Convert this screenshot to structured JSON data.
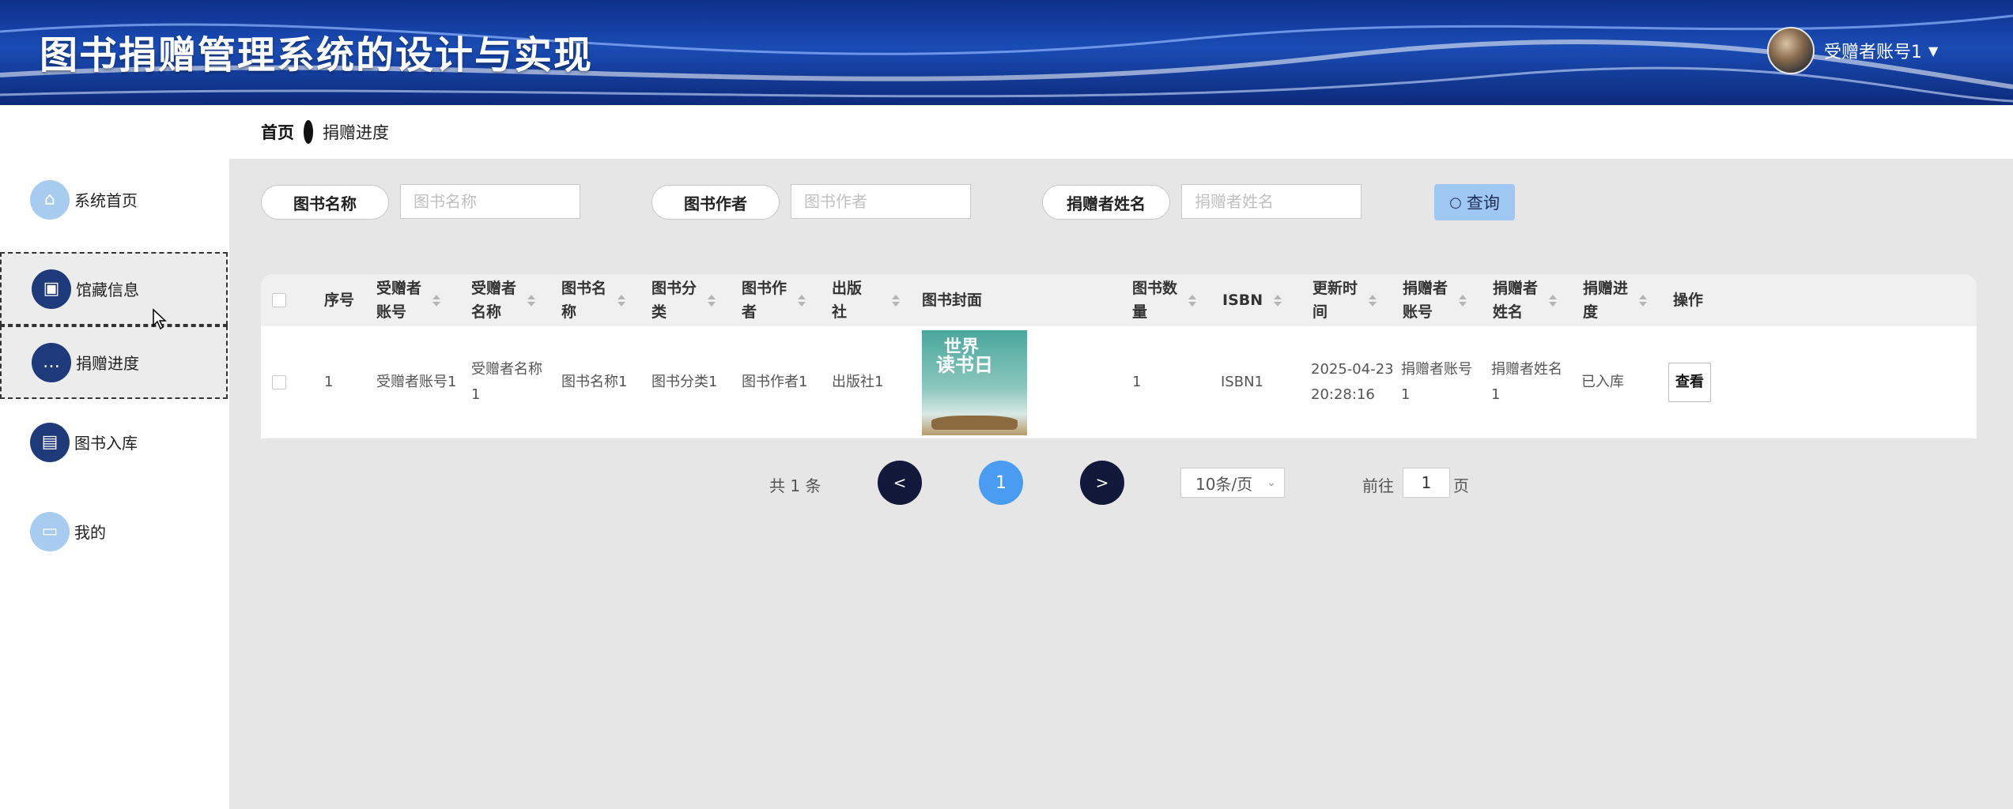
{
  "app": {
    "title": "图书捐赠管理系统的设计与实现"
  },
  "user": {
    "name": "受赠者账号1"
  },
  "sidebar": {
    "items": [
      {
        "label": "系统首页",
        "icon": "home-icon"
      },
      {
        "label": "馆藏信息",
        "icon": "briefcase-icon"
      },
      {
        "label": "捐赠进度",
        "icon": "message-icon"
      },
      {
        "label": "图书入库",
        "icon": "clipboard-icon"
      },
      {
        "label": "我的",
        "icon": "card-icon"
      }
    ]
  },
  "breadcrumb": {
    "home": "首页",
    "current": "捐赠进度"
  },
  "search": {
    "book_name_label": "图书名称",
    "book_name_placeholder": "图书名称",
    "author_label": "图书作者",
    "author_placeholder": "图书作者",
    "donor_name_label": "捐赠者姓名",
    "donor_name_placeholder": "捐赠者姓名",
    "query_label": "查询"
  },
  "table": {
    "headers": [
      "序号",
      "受赠者\n账号",
      "受赠者\n名称",
      "图书名\n称",
      "图书分\n类",
      "图书作\n者",
      "出版\n社",
      "图书封面",
      "图书数\n量",
      "ISBN",
      "更新时\n间",
      "捐赠者\n账号",
      "捐赠者\n姓名",
      "捐赠进\n度",
      "操作"
    ],
    "rows": [
      {
        "index": "1",
        "recipient_account": "受赠者账号1",
        "recipient_name": "受赠者名称\n1",
        "book_name": "图书名称1",
        "category": "图书分类1",
        "author": "图书作者1",
        "publisher": "出版社1",
        "cover_text_1": "世界",
        "cover_text_2": "读书日",
        "quantity": "1",
        "isbn": "ISBN1",
        "updated": "2025-04-23\n20:28:16",
        "donor_account": "捐赠者账号\n1",
        "donor_name": "捐赠者姓名\n1",
        "progress": "已入库",
        "action": "查看"
      }
    ]
  },
  "pagination": {
    "total": "共 1 条",
    "prev": "<",
    "current": "1",
    "next": ">",
    "page_size": "10条/页",
    "goto_prefix": "前往",
    "goto_value": "1",
    "goto_suffix": "页"
  },
  "colors": {
    "header_blue": "#0d2f8a",
    "query_button": "#9fc7f3",
    "active_page": "#4a9bf2",
    "page_button": "#11183a"
  }
}
